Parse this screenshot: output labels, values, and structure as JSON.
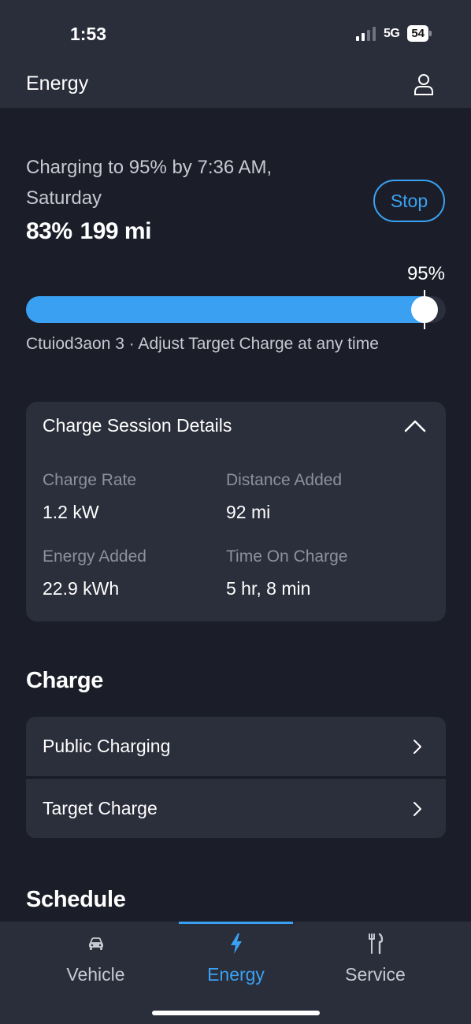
{
  "status_bar": {
    "time": "1:53",
    "network": "5G",
    "battery": "54"
  },
  "header": {
    "title": "Energy",
    "profile_icon": "person-icon"
  },
  "charging": {
    "status_text": "Charging to 95% by 7:36 AM, Saturday",
    "percent": "83%",
    "range": "199 mi",
    "stop_label": "Stop",
    "target_label": "95%",
    "current_level": 0.83,
    "target_level": 0.95,
    "hint": "Ctuiod3aon 3 · Adjust Target Charge at any time",
    "accent_color": "#3aa1f2"
  },
  "session_details": {
    "title": "Charge Session Details",
    "metrics": [
      {
        "label": "Charge Rate",
        "value": "1.2 kW"
      },
      {
        "label": "Distance Added",
        "value": "92 mi"
      },
      {
        "label": "Energy Added",
        "value": "22.9 kWh"
      },
      {
        "label": "Time On Charge",
        "value": "5 hr, 8 min"
      }
    ]
  },
  "charge_section": {
    "title": "Charge",
    "items": [
      {
        "label": "Public Charging"
      },
      {
        "label": "Target Charge"
      }
    ]
  },
  "schedule_section": {
    "title": "Schedule"
  },
  "bottom_nav": {
    "items": [
      {
        "label": "Vehicle",
        "icon": "car-icon"
      },
      {
        "label": "Energy",
        "icon": "lightning-icon",
        "active": true
      },
      {
        "label": "Service",
        "icon": "tools-icon"
      }
    ]
  }
}
